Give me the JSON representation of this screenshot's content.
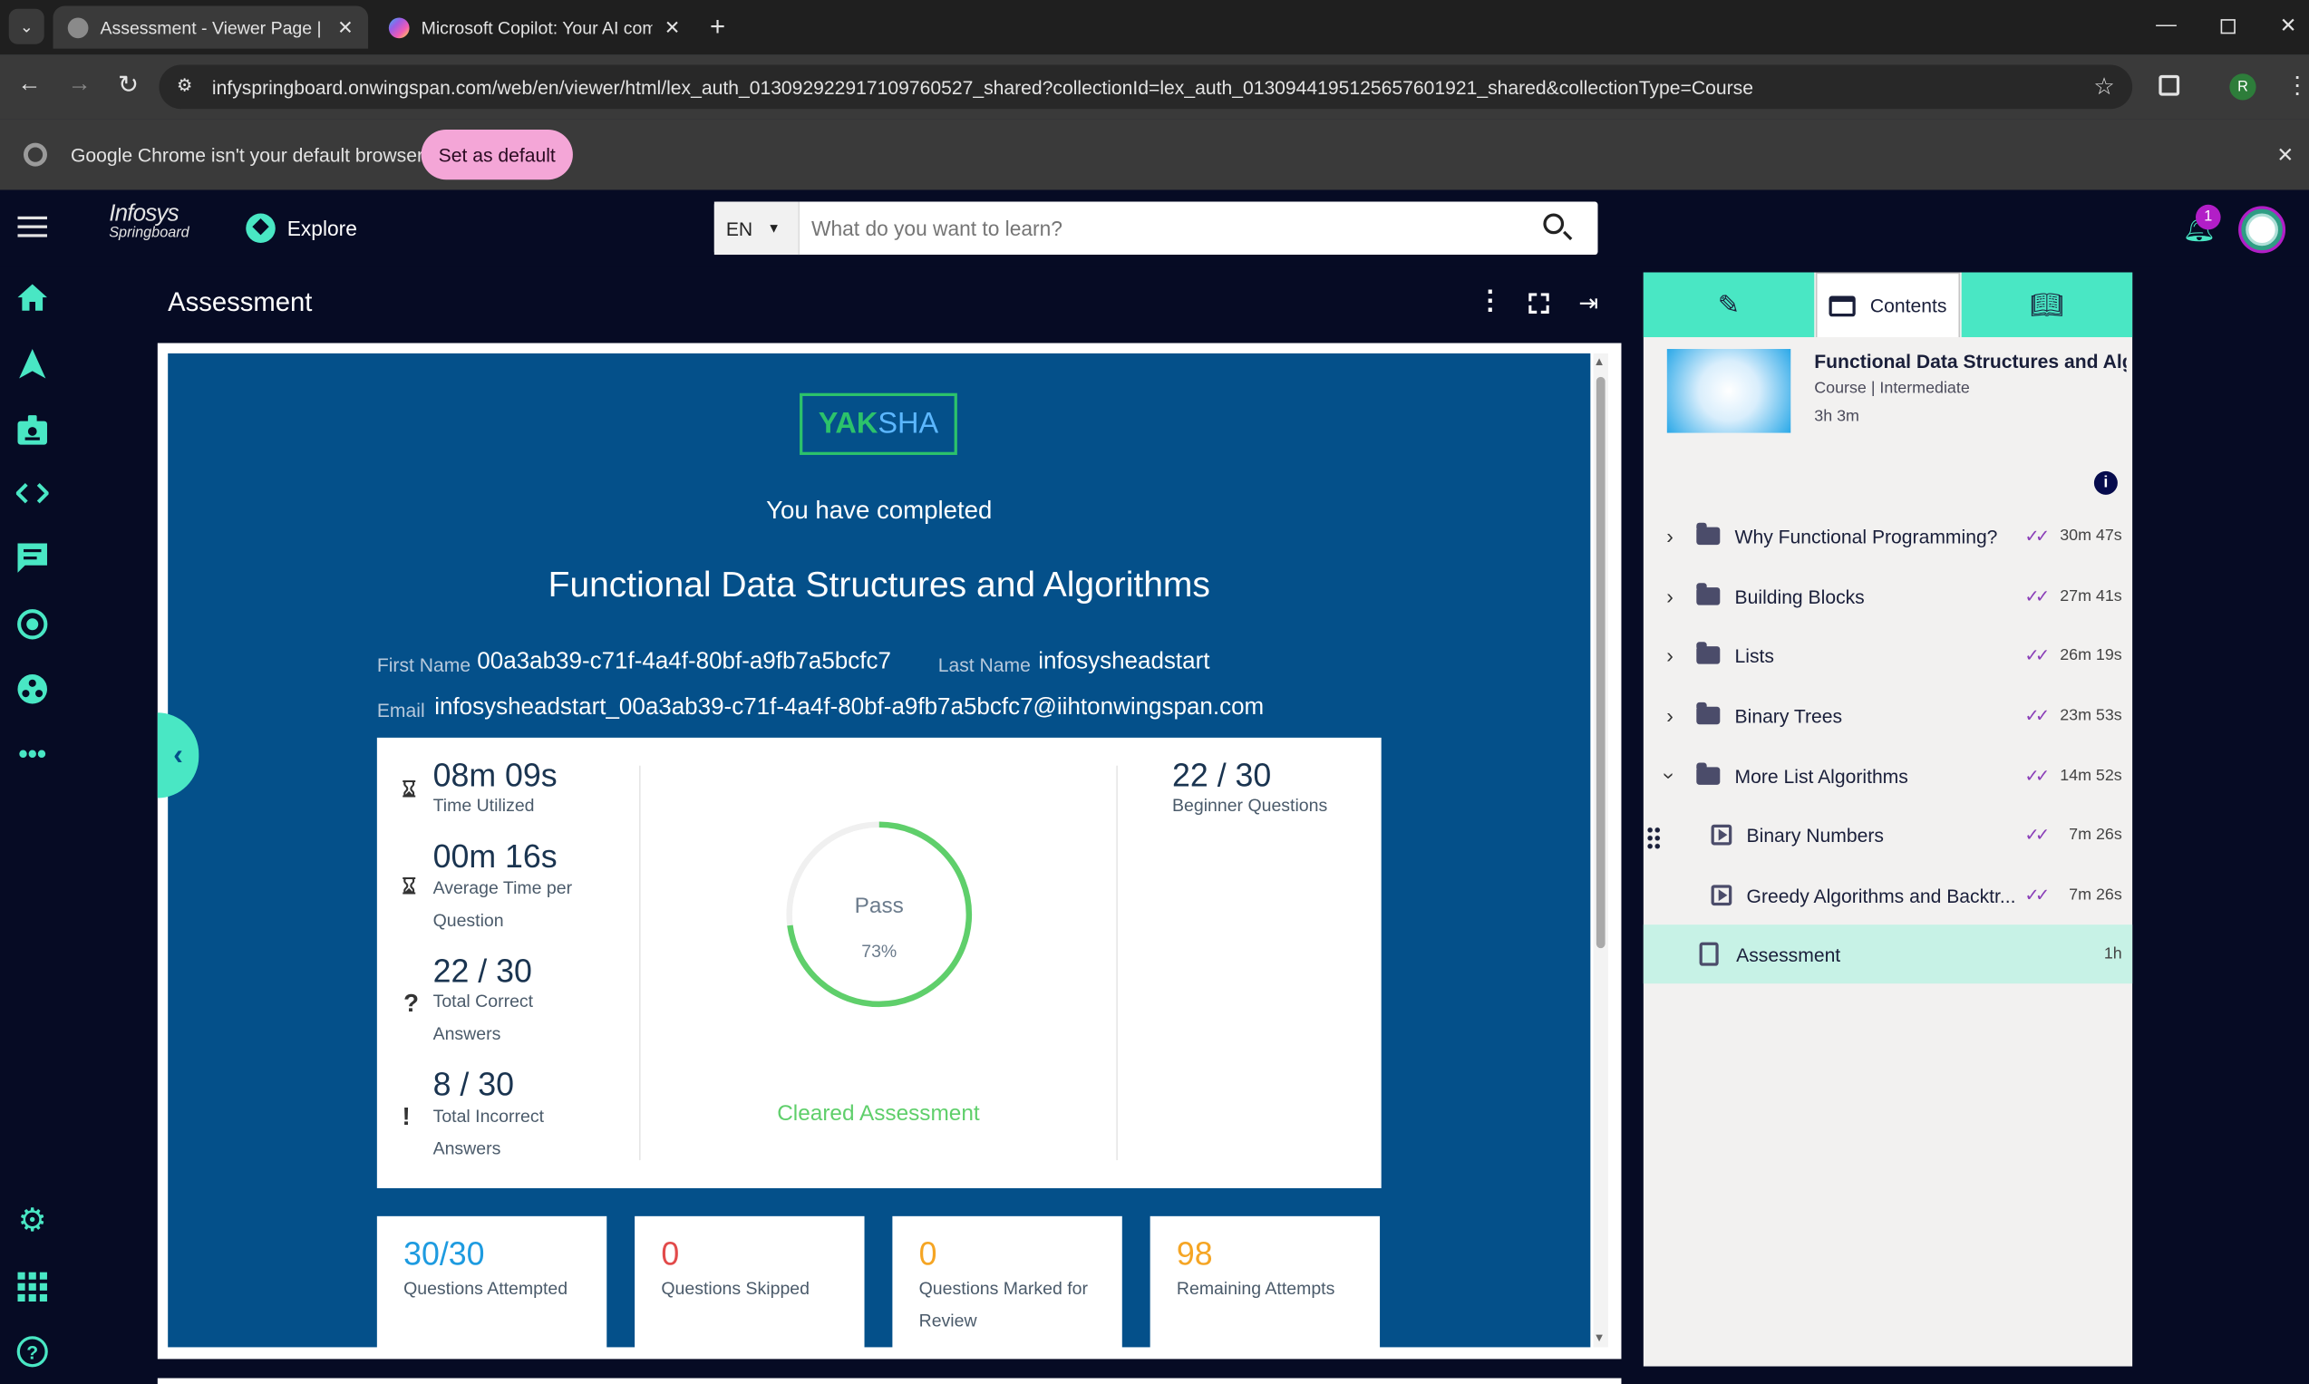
{
  "browser": {
    "tabs": [
      {
        "title": "Assessment - Viewer Page | Infosys Springboard",
        "active": true
      },
      {
        "title": "Microsoft Copilot: Your AI companion",
        "active": false
      }
    ],
    "url": "infyspringboard.onwingspan.com/web/en/viewer/html/lex_auth_013092922917109760527_shared?collectionId=lex_auth_0130944195125657601921_shared&collectionType=Course",
    "infobar_text": "Google Chrome isn't your default browser",
    "set_default_label": "Set as default",
    "profile_initial": "R"
  },
  "app": {
    "logo_line1": "Infosys",
    "logo_line2": "Springboard",
    "explore_label": "Explore",
    "lang": "EN",
    "search_placeholder": "What do you want to learn?",
    "notification_count": "1"
  },
  "viewer": {
    "title": "Assessment",
    "brand_yak": "YAK",
    "brand_sha": "SHA",
    "completed_text": "You have completed",
    "course_title": "Functional Data Structures and Algorithms",
    "first_name_label": "First Name",
    "first_name": "00a3ab39-c71f-4a4f-80bf-a9fb7a5bcfc7",
    "last_name_label": "Last Name",
    "last_name": "infosysheadstart",
    "email_label": "Email",
    "email": "infosysheadstart_00a3ab39-c71f-4a4f-80bf-a9fb7a5bcfc7@iihtonwingspan.com",
    "stats": {
      "time_utilized": "08m 09s",
      "time_utilized_label": "Time Utilized",
      "avg_time": "00m 16s",
      "avg_time_label_1": "Average Time per",
      "avg_time_label_2": "Question",
      "total_correct": "22 / 30",
      "total_correct_label_1": "Total Correct",
      "total_correct_label_2": "Answers",
      "total_incorrect": "8 / 30",
      "total_incorrect_label_1": "Total Incorrect",
      "total_incorrect_label_2": "Answers"
    },
    "result": {
      "status": "Pass",
      "percent_text": "73%",
      "percent": 0.73,
      "cleared_text": "Cleared Assessment",
      "ring_color": "#5fcf6b"
    },
    "level": {
      "value": "22 / 30",
      "label": "Beginner Questions"
    },
    "bottom_cards": [
      {
        "value": "30/30",
        "label": "Questions Attempted",
        "color": "#1e9be0"
      },
      {
        "value": "0",
        "label": "Questions Skipped",
        "color": "#e24a4a"
      },
      {
        "value": "0",
        "label": "Questions Marked for Review",
        "color": "#f5a524"
      },
      {
        "value": "98",
        "label": "Remaining Attempts",
        "color": "#f5a524"
      }
    ]
  },
  "contents": {
    "tab_label": "Contents",
    "course_title": "Functional Data Structures and Alg...",
    "course_meta": "Course | Intermediate",
    "course_duration": "3h 3m",
    "items": [
      {
        "title": "Why Functional Programming?",
        "duration": "30m 47s"
      },
      {
        "title": "Building Blocks",
        "duration": "27m 41s"
      },
      {
        "title": "Lists",
        "duration": "26m 19s"
      },
      {
        "title": "Binary Trees",
        "duration": "23m 53s"
      },
      {
        "title": "More List Algorithms",
        "duration": "14m 52s"
      },
      {
        "title": "Binary Numbers",
        "duration": "7m 26s"
      },
      {
        "title": "Greedy Algorithms and Backtr...",
        "duration": "7m 26s"
      },
      {
        "title": "Assessment",
        "duration": "1h"
      }
    ]
  }
}
